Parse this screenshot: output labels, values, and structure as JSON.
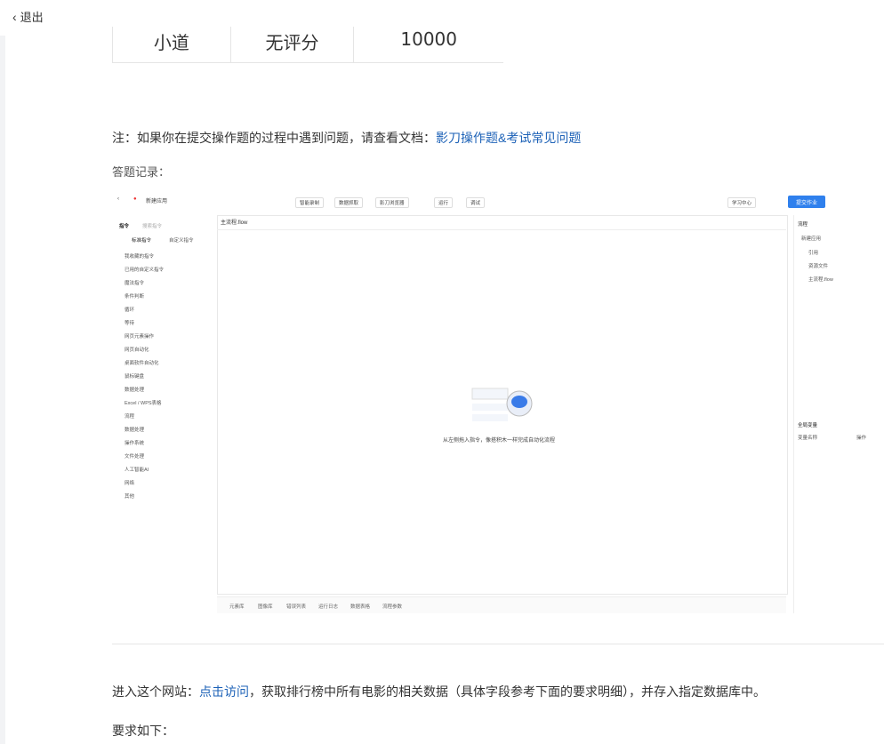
{
  "exit": {
    "label": "退出"
  },
  "table_row": [
    "小道",
    "无评分",
    "10000"
  ],
  "note": {
    "prefix": "注：如果你在提交操作题的过程中遇到问题，请查看文档：",
    "link": "影刀操作题&考试常见问题"
  },
  "answer_record_label": "答题记录：",
  "screenshot": {
    "app_title": "新建应用",
    "toolbar": [
      "智能录制",
      "数据抓取",
      "影刀浏览器",
      "运行",
      "调试"
    ],
    "learning_center": "学习中心",
    "publish": "提交作业",
    "left_header": "指令",
    "search_placeholder": "搜索指令",
    "left_tabs": [
      "标准指令",
      "自定义指令"
    ],
    "left_items": [
      "我收藏的指令",
      "已用的自定义指令",
      "魔法指令",
      "条件判断",
      "循环",
      "等待",
      "网页元素操作",
      "网页自动化",
      "桌面软件自动化",
      "鼠标键盘",
      "数据处理",
      "Excel / WPS表格",
      "流程",
      "数据处理",
      "操作系统",
      "文件处理",
      "人工智能AI",
      "网络",
      "其他"
    ],
    "main_tab": "主流程.flow",
    "empty_hint": "从左侧拖入指令，像搭积木一样完成自动化流程",
    "bottom_tabs": [
      "元素库",
      "图像库",
      "错误列表",
      "运行日志",
      "数据表格",
      "流程参数"
    ],
    "right_header": "流程",
    "right_items": [
      "新建应用",
      "引用",
      "资源文件",
      "主流程.flow"
    ],
    "right_header2": "全局变量",
    "right_cols": [
      "变量名称",
      "操作"
    ]
  },
  "visit": {
    "prefix": "进入这个网站：",
    "link": "点击访问",
    "suffix": "，获取排行榜中所有电影的相关数据（具体字段参考下面的要求明细），并存入指定数据库中。"
  },
  "requirements_label": "要求如下："
}
